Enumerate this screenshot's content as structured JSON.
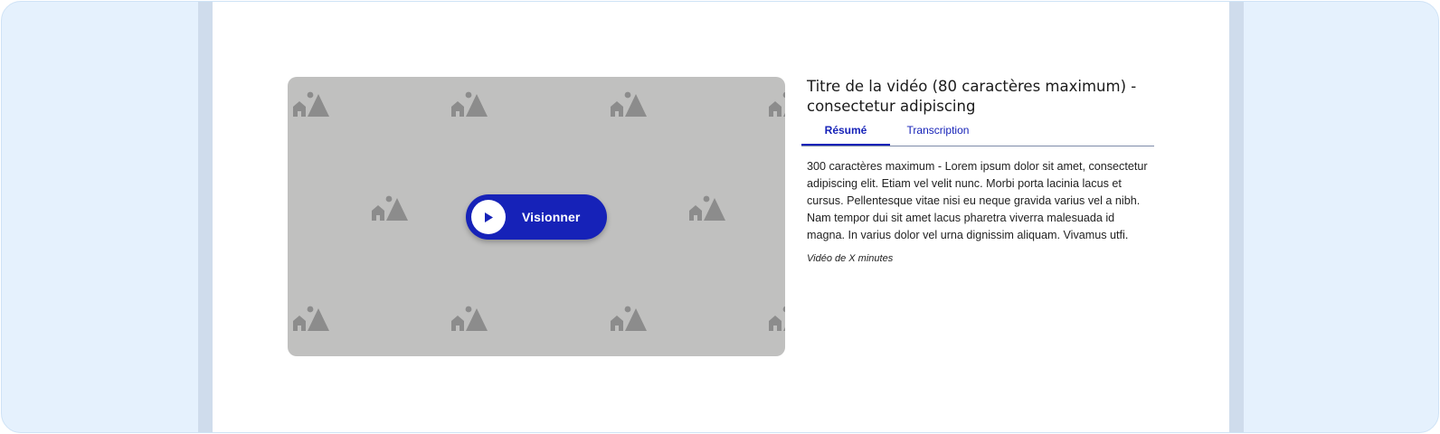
{
  "video": {
    "play_label": "Visionner",
    "play_icon": "play-icon",
    "placeholder_icon": "image-placeholder-icon"
  },
  "info": {
    "title": "Titre de la vidéo (80 caractères maximum) - consectetur adipiscing",
    "tabs": [
      {
        "label": "Résumé",
        "active": true
      },
      {
        "label": "Transcription",
        "active": false
      }
    ],
    "summary": "300 caractères maximum - Lorem ipsum dolor sit amet, consectetur adipiscing elit. Etiam vel velit nunc. Morbi porta lacinia lacus et cursus. Pellentesque vitae nisi eu neque gravida varius vel a nibh. Nam tempor dui sit amet lacus pharetra viverra malesuada id magna. In varius dolor vel urna dignissim aliquam. Vivamus utfi.",
    "duration": "Vidéo de X minutes"
  },
  "colors": {
    "accent": "#1622b8",
    "frame_bg": "#e5f1fd",
    "placeholder_bg": "#c0c0bf"
  }
}
